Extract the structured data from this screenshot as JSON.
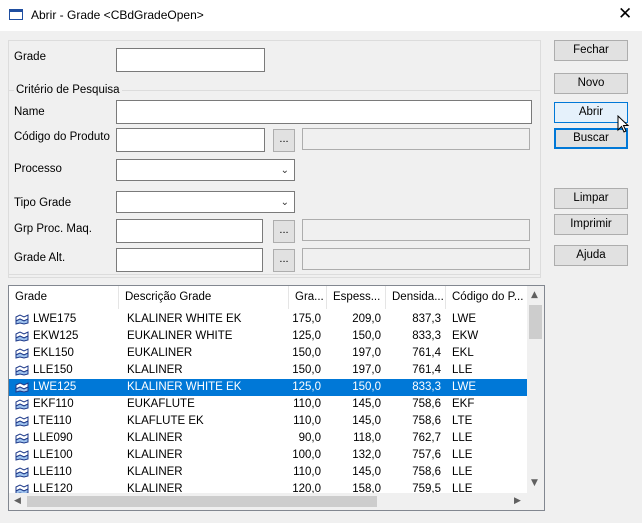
{
  "window": {
    "title": "Abrir - Grade <CBdGradeOpen>",
    "close_glyph": "✕"
  },
  "form": {
    "grade_label": "Grade",
    "grade_value": "",
    "group_title": "Critério de Pesquisa",
    "name_label": "Name",
    "name_value": "",
    "codigo_label": "Código do Produto",
    "codigo_value": "",
    "processo_label": "Processo",
    "processo_value": "",
    "tipo_label": "Tipo Grade",
    "tipo_value": "",
    "grp_label": "Grp Proc. Maq.",
    "grp_value": "",
    "alt_label": "Grade Alt.",
    "alt_value": "",
    "ellipsis": "...",
    "combo_arrow": "⌄"
  },
  "buttons": {
    "fechar": "Fechar",
    "novo": "Novo",
    "abrir": "Abrir",
    "buscar": "Buscar",
    "limpar": "Limpar",
    "imprimir": "Imprimir",
    "ajuda": "Ajuda"
  },
  "grid": {
    "columns": [
      "Grade",
      "Descrição Grade",
      "Gra...",
      "Espess...",
      "Densida...",
      "Código do P..."
    ],
    "row_icon": "grade-record-icon",
    "rows": [
      {
        "grade": "LWE175",
        "descricao": "KLALINER WHITE EK",
        "gramatura": "175,0",
        "espessura": "209,0",
        "densidade": "837,3",
        "codigo": "LWE"
      },
      {
        "grade": "EKW125",
        "descricao": "EUKALINER WHITE",
        "gramatura": "125,0",
        "espessura": "150,0",
        "densidade": "833,3",
        "codigo": "EKW"
      },
      {
        "grade": "EKL150",
        "descricao": "EUKALINER",
        "gramatura": "150,0",
        "espessura": "197,0",
        "densidade": "761,4",
        "codigo": "EKL"
      },
      {
        "grade": "LLE150",
        "descricao": "KLALINER",
        "gramatura": "150,0",
        "espessura": "197,0",
        "densidade": "761,4",
        "codigo": "LLE"
      },
      {
        "grade": "LWE125",
        "descricao": "KLALINER WHITE EK",
        "gramatura": "125,0",
        "espessura": "150,0",
        "densidade": "833,3",
        "codigo": "LWE"
      },
      {
        "grade": "EKF110",
        "descricao": "EUKAFLUTE",
        "gramatura": "110,0",
        "espessura": "145,0",
        "densidade": "758,6",
        "codigo": "EKF"
      },
      {
        "grade": "LTE110",
        "descricao": "KLAFLUTE EK",
        "gramatura": "110,0",
        "espessura": "145,0",
        "densidade": "758,6",
        "codigo": "LTE"
      },
      {
        "grade": "LLE090",
        "descricao": "KLALINER",
        "gramatura": "90,0",
        "espessura": "118,0",
        "densidade": "762,7",
        "codigo": "LLE"
      },
      {
        "grade": "LLE100",
        "descricao": "KLALINER",
        "gramatura": "100,0",
        "espessura": "132,0",
        "densidade": "757,6",
        "codigo": "LLE"
      },
      {
        "grade": "LLE110",
        "descricao": "KLALINER",
        "gramatura": "110,0",
        "espessura": "145,0",
        "densidade": "758,6",
        "codigo": "LLE"
      },
      {
        "grade": "LLE120",
        "descricao": "KLALINER",
        "gramatura": "120,0",
        "espessura": "158,0",
        "densidade": "759,5",
        "codigo": "LLE"
      }
    ],
    "selected_index": 4,
    "scroll_up": "▲",
    "scroll_down": "▼",
    "scroll_left": "◀",
    "scroll_right": "▶",
    "colors": {
      "selection": "#0078d7",
      "selection_text": "#ffffff"
    }
  }
}
